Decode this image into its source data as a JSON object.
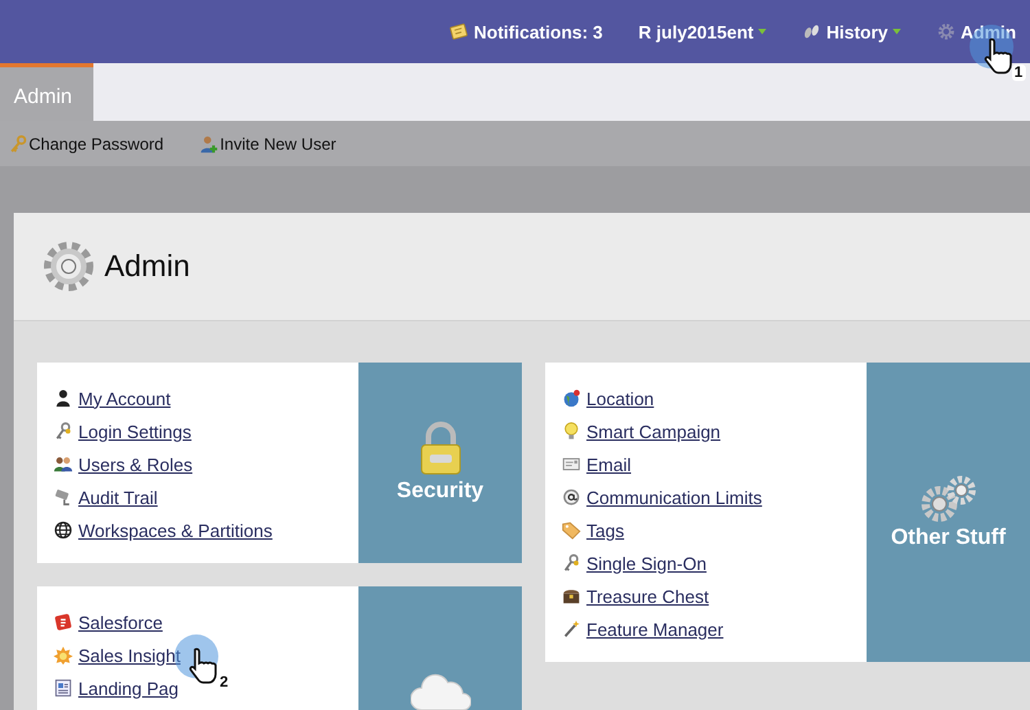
{
  "top_bar": {
    "items": [
      {
        "label": "Notifications: 3",
        "dropdown": false
      },
      {
        "label": "R july2015ent",
        "dropdown": true
      },
      {
        "label": "History",
        "dropdown": true
      },
      {
        "label": "Admin",
        "dropdown": false,
        "tour_step": "1"
      }
    ]
  },
  "tabs": [
    {
      "label": "Admin",
      "selected": true
    }
  ],
  "toolbar": {
    "items": [
      {
        "label": "Change Password"
      },
      {
        "label": "Invite New User"
      }
    ]
  },
  "page": {
    "title": "Admin"
  },
  "columns": [
    {
      "cards": [
        {
          "tile": {
            "label": "Security"
          },
          "items": [
            {
              "label": "My Account"
            },
            {
              "label": "Login Settings"
            },
            {
              "label": "Users & Roles"
            },
            {
              "label": "Audit Trail"
            },
            {
              "label": "Workspaces & Partitions"
            }
          ]
        },
        {
          "items": [
            {
              "label": "Salesforce"
            },
            {
              "label": "Sales Insight",
              "tour_step": "2"
            },
            {
              "label": "Landing Pag"
            }
          ]
        }
      ]
    },
    {
      "cards": [
        {
          "tile": {
            "label": "Other Stuff"
          },
          "items": [
            {
              "label": "Location"
            },
            {
              "label": "Smart Campaign"
            },
            {
              "label": "Email"
            },
            {
              "label": "Communication Limits"
            },
            {
              "label": "Tags"
            },
            {
              "label": "Single Sign-On"
            },
            {
              "label": "Treasure Chest"
            },
            {
              "label": "Feature Manager"
            }
          ]
        }
      ]
    }
  ]
}
